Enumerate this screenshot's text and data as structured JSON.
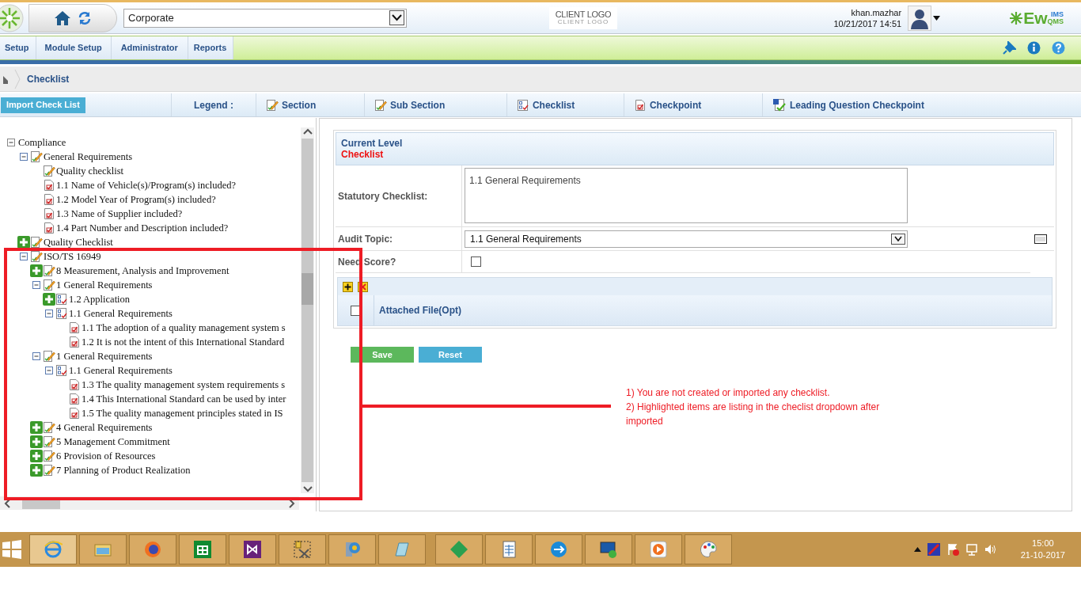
{
  "header": {
    "org_select": "Corporate",
    "client_logo": "CLIENT LOGO",
    "client_logo_sub": "CLIENT LOGO",
    "user": "khan.mazhar",
    "datetime": "10/21/2017 14:51",
    "brand": "Ew",
    "brand_sup": "IMS",
    "brand_sub": "QMS"
  },
  "menu": [
    "Setup",
    "Module Setup",
    "Administrator",
    "Reports"
  ],
  "breadcrumb": "Checklist",
  "toolbar": {
    "import_button": "Import Check List",
    "legend_label": "Legend :",
    "legend": [
      {
        "kind": "section",
        "label": "Section"
      },
      {
        "kind": "subsection",
        "label": "Sub Section"
      },
      {
        "kind": "checklist",
        "label": "Checklist"
      },
      {
        "kind": "checkpoint",
        "label": "Checkpoint"
      },
      {
        "kind": "leading",
        "label": "Leading Question Checkpoint"
      }
    ]
  },
  "tree": [
    {
      "kind": "group",
      "label": "Compliance",
      "expanded": true,
      "children": [
        {
          "kind": "section",
          "label": "General Requirements",
          "expanded": true,
          "children": [
            {
              "kind": "section",
              "label": "Quality checklist"
            },
            {
              "kind": "checkpoint",
              "label": "1.1 Name of Vehicle(s)/Program(s) included?"
            },
            {
              "kind": "checkpoint",
              "label": "1.2 Model Year of Program(s) included?"
            },
            {
              "kind": "checkpoint",
              "label": "1.3 Name of Supplier included?"
            },
            {
              "kind": "checkpoint",
              "label": "1.4 Part Number and Description included?"
            }
          ]
        },
        {
          "kind": "section",
          "label": "Quality Checklist",
          "expanded": false
        },
        {
          "kind": "section",
          "label": "ISO/TS 16949",
          "expanded": true,
          "children": [
            {
              "kind": "section",
              "label": "8 Measurement, Analysis and Improvement",
              "expanded": false
            },
            {
              "kind": "section",
              "label": "1 General Requirements",
              "expanded": true,
              "children": [
                {
                  "kind": "checklist",
                  "label": "1.2 Application",
                  "expanded": false
                },
                {
                  "kind": "checklist",
                  "label": "1.1 General Requirements",
                  "expanded": true,
                  "children": [
                    {
                      "kind": "checkpoint",
                      "label": "1.1 The adoption of a quality management system s"
                    },
                    {
                      "kind": "checkpoint",
                      "label": "1.2 It is not the intent of this International Standard"
                    }
                  ]
                }
              ]
            },
            {
              "kind": "section",
              "label": "1 General Requirements",
              "expanded": true,
              "children": [
                {
                  "kind": "checklist",
                  "label": "1.1 General Requirements",
                  "expanded": true,
                  "children": [
                    {
                      "kind": "checkpoint",
                      "label": "1.3 The quality management system requirements s"
                    },
                    {
                      "kind": "checkpoint",
                      "label": "1.4 This International Standard can be used by inter"
                    },
                    {
                      "kind": "checkpoint",
                      "label": "1.5 The quality management principles stated in IS"
                    }
                  ]
                }
              ]
            },
            {
              "kind": "section",
              "label": "4 General Requirements",
              "expanded": false
            },
            {
              "kind": "section",
              "label": "5 Management Commitment",
              "expanded": false
            },
            {
              "kind": "section",
              "label": "6 Provision of Resources",
              "expanded": false
            },
            {
              "kind": "section",
              "label": "7 Planning of Product Realization",
              "expanded": false
            }
          ]
        }
      ]
    }
  ],
  "form": {
    "current_level_label": "Current Level",
    "current_level": "Checklist",
    "fields": [
      {
        "kind": "textarea",
        "label": "Statutory Checklist:",
        "value": "1.1 General Requirements"
      },
      {
        "kind": "select",
        "label": "Audit Topic:",
        "value": "1.1 General Requirements"
      },
      {
        "kind": "checkbox",
        "label": "Need Score?",
        "checked": false
      }
    ],
    "attachments": {
      "select_all_checked": false,
      "column": "Attached File(Opt)"
    },
    "buttons": [
      {
        "kind": "save",
        "label": "Save"
      },
      {
        "kind": "reset",
        "label": "Reset"
      }
    ]
  },
  "annotation": {
    "notes": [
      "1) You are not created or imported any checklist.",
      "2) Highlighted items are listing in the checlist dropdown after imported"
    ]
  },
  "taskbar": {
    "clock_time": "15:00",
    "clock_date": "21-10-2017"
  }
}
